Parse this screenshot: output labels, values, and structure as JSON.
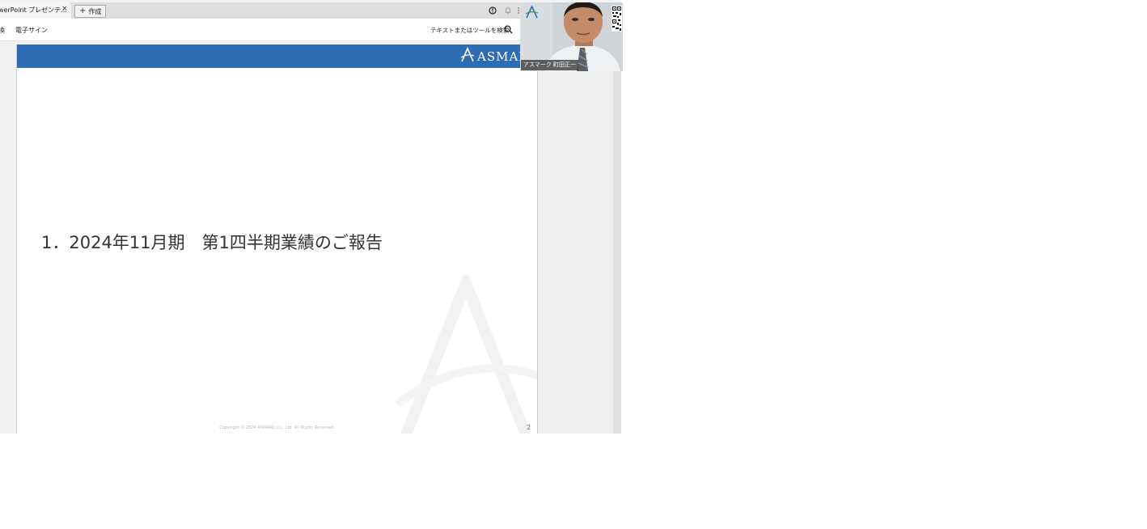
{
  "browser": {
    "tab_title": "werPoint プレゼンテ...",
    "tab_close": "×",
    "new_button_label": "作成",
    "new_button_icon": "plus-icon",
    "icons": [
      "alert-circle-icon",
      "bell-icon",
      "more-icon"
    ]
  },
  "toolbar": {
    "left_partial": "換",
    "esign_label": "電子サイン",
    "search_label": "テキストまたはツールを検索",
    "search_icon": "search-icon"
  },
  "slide": {
    "header_color": "#2e6db4",
    "logo_text": "ASMAR",
    "title": "1．2024年11月期　第1四半期業績のご報告",
    "copyright": "Copyright © 2024 ASMARQ Co., Ltd. All Rights Reserved.",
    "page_number": "2"
  },
  "webcam": {
    "name_tag": "アスマーク 町田正一"
  }
}
